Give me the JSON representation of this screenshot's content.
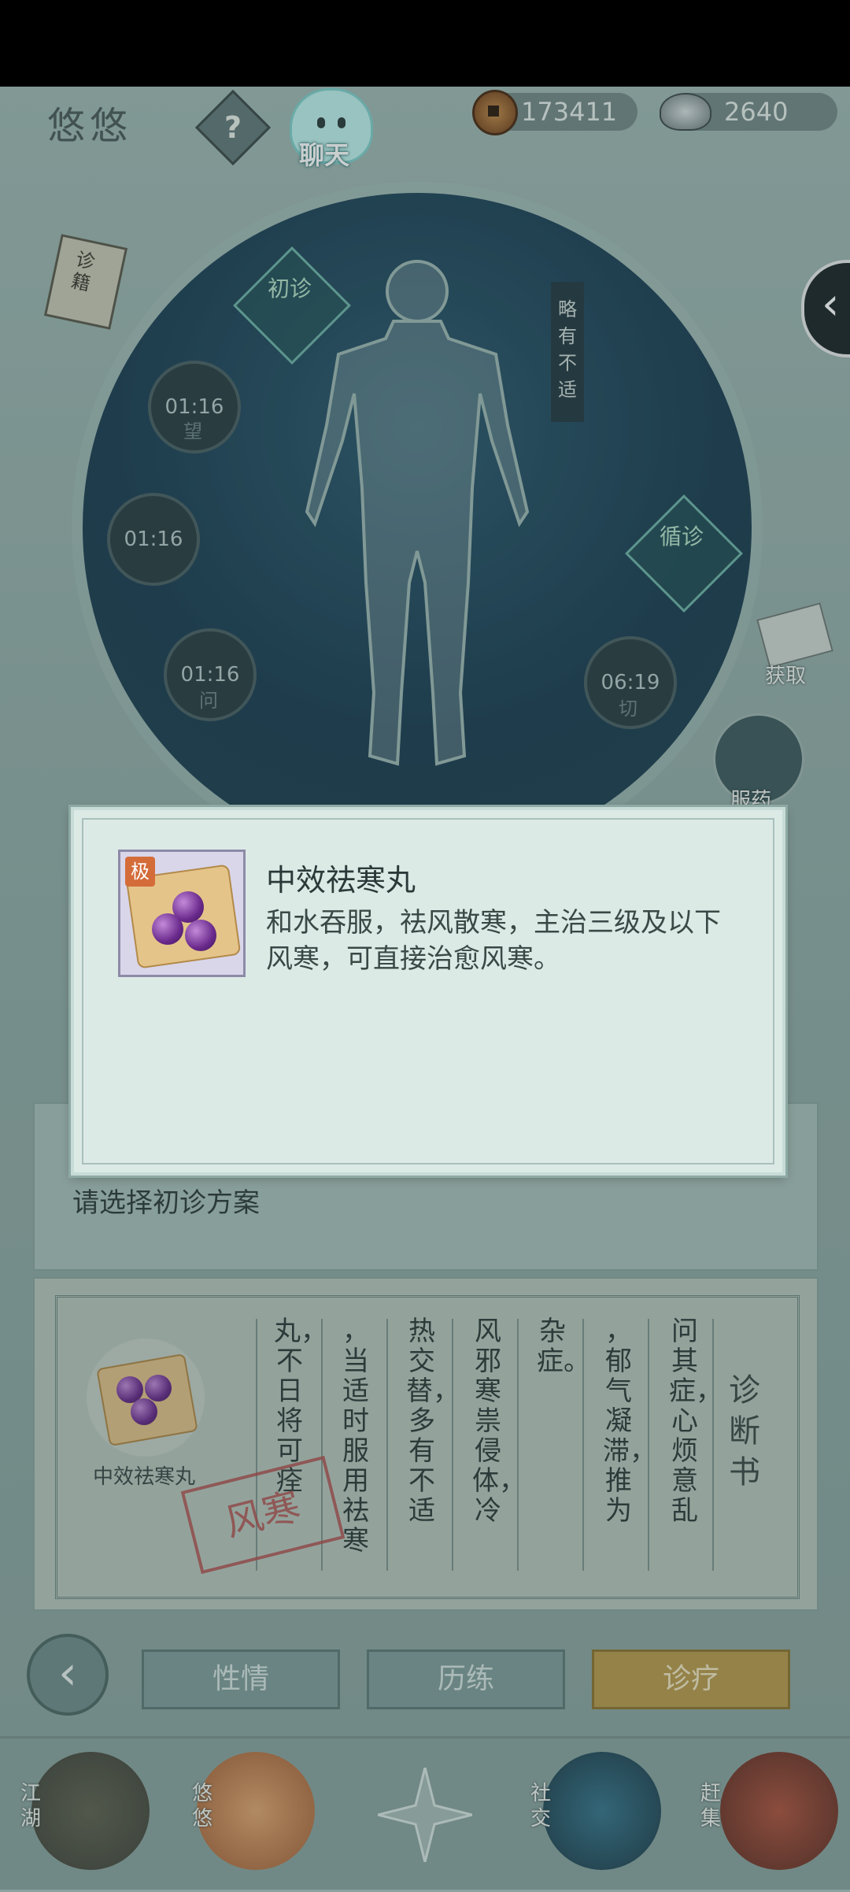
{
  "header": {
    "player_name": "悠悠",
    "help_label": "?",
    "chat_label": "聊天",
    "copper_amount": "173411",
    "silver_amount": "2640"
  },
  "sidebar": {
    "book_label": "诊籍",
    "obtain_label": "获取",
    "take_medicine_label": "服药"
  },
  "diagnosis_wheel": {
    "first_diag_label": "初诊",
    "second_diag_label": "循诊",
    "status_banner": "略有不适",
    "timers": [
      {
        "time": "01:16",
        "method": "望"
      },
      {
        "time": "01:16",
        "method": ""
      },
      {
        "time": "01:16",
        "method": "问"
      },
      {
        "time": "06:19",
        "method": "切"
      }
    ]
  },
  "modal": {
    "grade_badge": "极",
    "item_name": "中效祛寒丸",
    "item_description": "和水吞服，祛风散寒，主治三级及以下风寒，可直接治愈风寒。"
  },
  "prompt": {
    "text": "请选择初诊方案"
  },
  "diagnosis_sheet": {
    "title": "诊断书",
    "columns": [
      "问其症，心烦意乱",
      "，郁气凝滞，推为",
      "杂症。",
      "风邪寒祟侵体，冷",
      "热交替，多有不适",
      "，当适时服用祛寒",
      "丸，不日将可痊"
    ],
    "medicine_label": "中效祛寒丸",
    "stamp_text": "风寒"
  },
  "action_tabs": {
    "back_icon": "chevron-left-icon",
    "temperament": "性情",
    "experience": "历练",
    "treatment": "诊疗"
  },
  "bottom_nav": {
    "jianghu": "江湖",
    "youyou": "悠悠",
    "social": "社交",
    "market": "赶集"
  }
}
